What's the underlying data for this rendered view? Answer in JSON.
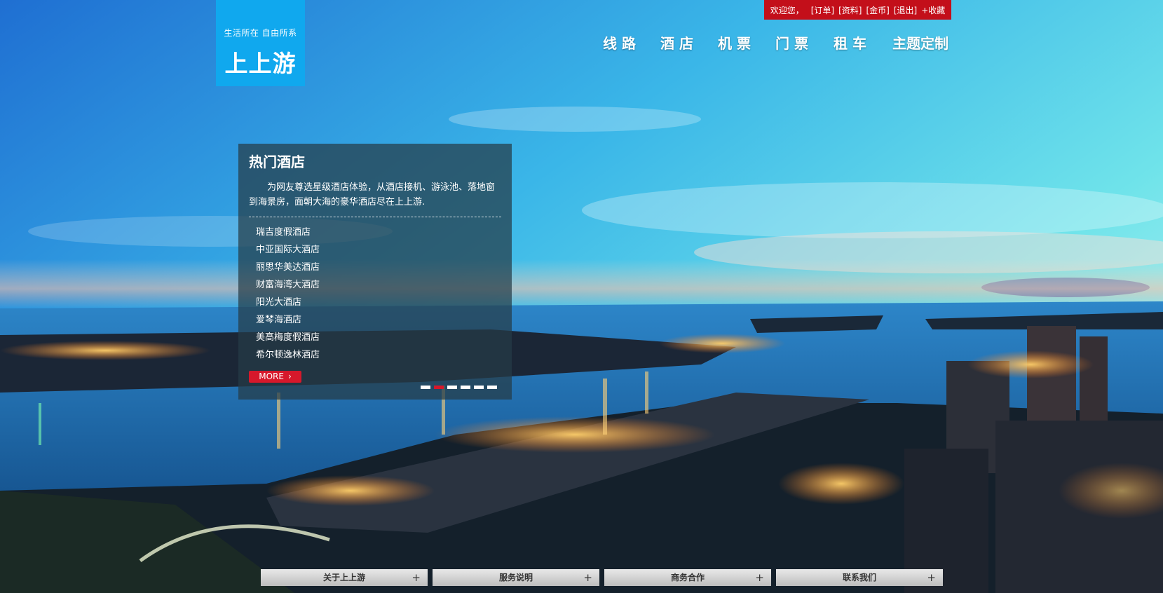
{
  "header": {
    "tagline": "生活所在 自由所系",
    "brand": "上上游",
    "userbar": {
      "welcome": "欢迎您，",
      "links": [
        "[订单]",
        "[资料]",
        "[金币]",
        "[退出]",
        "+收藏"
      ]
    },
    "nav": [
      "线路",
      "酒店",
      "机票",
      "门票",
      "租车",
      "主题定制"
    ]
  },
  "hot_hotels": {
    "title": "热门酒店",
    "description": "为网友尊选星级酒店体验，从酒店接机、游泳池、落地窗到海景房，面朝大海的豪华酒店尽在上上游.",
    "items": [
      "瑞吉度假酒店",
      "中亚国际大酒店",
      "丽思华美达酒店",
      "财富海湾大酒店",
      "阳光大酒店",
      "爱琴海酒店",
      "美高梅度假酒店",
      "希尔顿逸林酒店"
    ],
    "more_label": "MORE",
    "slide_count": 6,
    "active_slide": 2
  },
  "footer": {
    "tabs": [
      "关于上上游",
      "服务说明",
      "商务合作",
      "联系我们"
    ],
    "plus": "+"
  },
  "colors": {
    "logo_bg": "#10a8ee",
    "userbar_bg": "#c30f1a",
    "accent_red": "#d6182b"
  }
}
